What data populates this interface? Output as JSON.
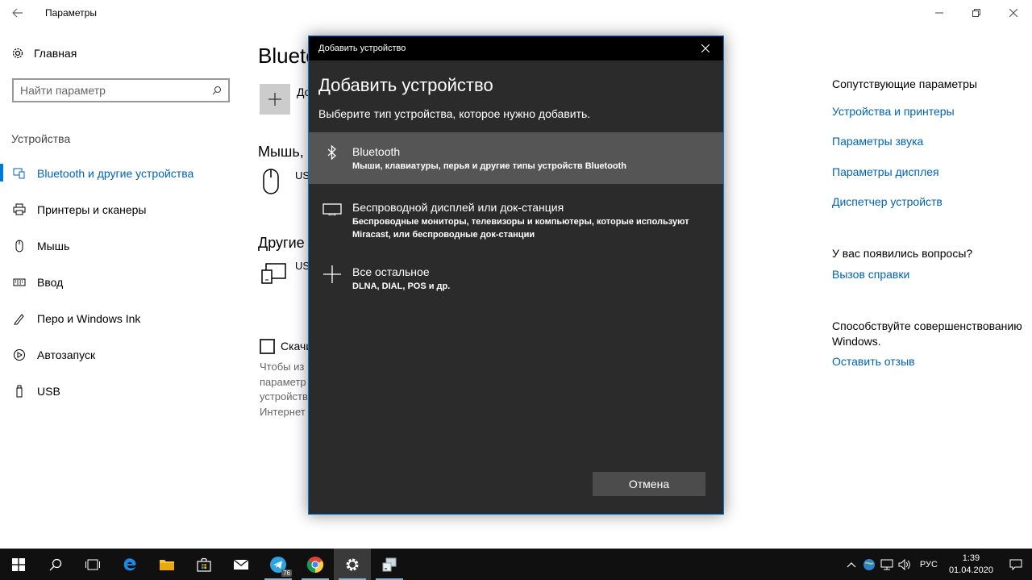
{
  "window": {
    "title": "Параметры"
  },
  "sidebar": {
    "home_label": "Главная",
    "search_placeholder": "Найти параметр",
    "section_label": "Устройства",
    "items": [
      {
        "label": "Bluetooth и другие устройства",
        "icon": "bluetooth-devices-icon",
        "active": true
      },
      {
        "label": "Принтеры и сканеры",
        "icon": "printer-icon"
      },
      {
        "label": "Мышь",
        "icon": "mouse-icon"
      },
      {
        "label": "Ввод",
        "icon": "keyboard-icon"
      },
      {
        "label": "Перо и Windows Ink",
        "icon": "pen-icon"
      },
      {
        "label": "Автозапуск",
        "icon": "autoplay-icon"
      },
      {
        "label": "USB",
        "icon": "usb-icon"
      }
    ]
  },
  "main": {
    "title": "Blueto",
    "add_label": "До",
    "mouse_heading": "Мышь,",
    "mouse_device": "US",
    "other_heading": "Другие",
    "other_device": "US",
    "checkbox_label": "Скачи",
    "note_lines": [
      "Чтобы из",
      "параметр",
      "устройств",
      "Интернет"
    ]
  },
  "right": {
    "related_heading": "Сопутствующие параметры",
    "links": [
      "Устройства и принтеры",
      "Параметры звука",
      "Параметры дисплея",
      "Диспетчер устройств"
    ],
    "questions_heading": "У вас появились вопросы?",
    "help_link": "Вызов справки",
    "improve_text": "Способствуйте совершенствованию Windows.",
    "feedback_link": "Оставить отзыв"
  },
  "dialog": {
    "window_title": "Добавить устройство",
    "heading": "Добавить устройство",
    "subtitle": "Выберите тип устройства, которое нужно добавить.",
    "options": [
      {
        "title": "Bluetooth",
        "desc": "Мыши, клавиатуры, перья и другие типы устройств Bluetooth",
        "icon": "bluetooth-icon",
        "selected": true
      },
      {
        "title": "Беспроводной дисплей или док-станция",
        "desc": "Беспроводные мониторы, телевизоры и компьютеры, которые используют Miracast, или беспроводные док-станции",
        "icon": "monitor-icon"
      },
      {
        "title": "Все остальное",
        "desc": "DLNA, DIAL, POS и др.",
        "icon": "plus-icon"
      }
    ],
    "cancel_label": "Отмена"
  },
  "taskbar": {
    "telegram_badge": "76",
    "language": "РУС",
    "time": "1:39",
    "date": "01.04.2020"
  },
  "colors": {
    "accent": "#0078d7",
    "link": "#0063b1",
    "dialog_bg": "#2b2b2b",
    "taskbar_bg": "#101010"
  }
}
